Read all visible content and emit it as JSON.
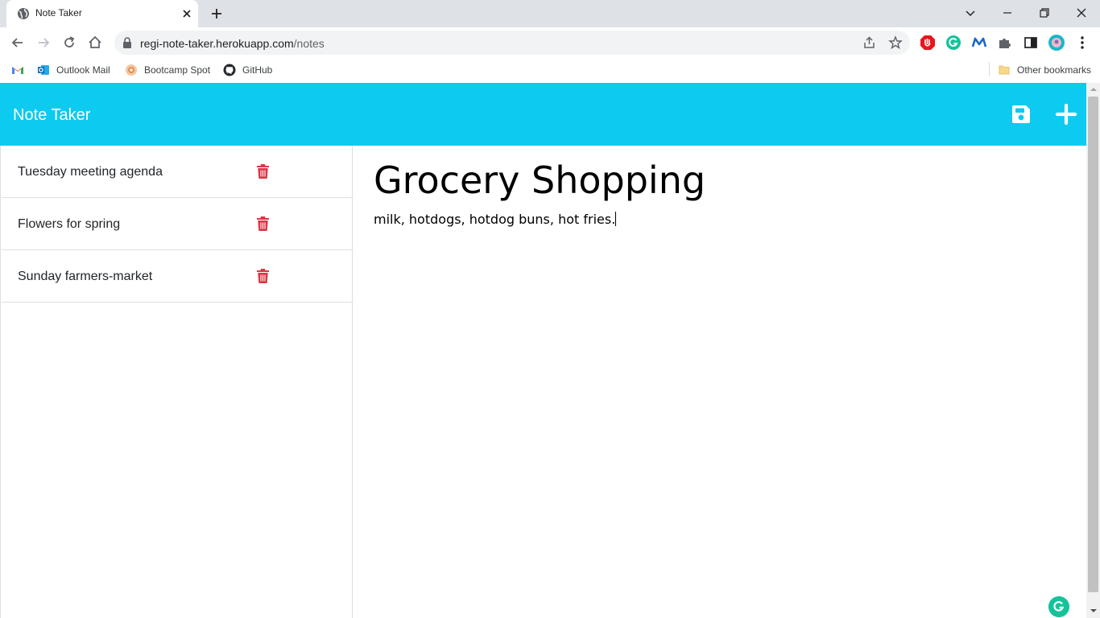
{
  "browser": {
    "tab_title": "Note Taker",
    "url_host": "regi-note-taker.herokuapp.com",
    "url_path": "/notes",
    "bookmarks": [
      {
        "label": "Outlook Mail"
      },
      {
        "label": "Bootcamp Spot"
      },
      {
        "label": "GitHub"
      }
    ],
    "other_bookmarks": "Other bookmarks"
  },
  "app": {
    "title": "Note Taker",
    "accent_color": "#0dcaf0",
    "delete_color": "#dc3545"
  },
  "notes": [
    {
      "title": "Tuesday meeting agenda"
    },
    {
      "title": "Flowers for spring"
    },
    {
      "title": "Sunday farmers-market"
    }
  ],
  "active_note": {
    "title": "Grocery Shopping",
    "text": "milk, hotdogs, hotdog buns, hot fries."
  },
  "icons": {
    "save": "floppy-disk-icon",
    "new": "plus-icon",
    "delete": "trash-icon"
  }
}
